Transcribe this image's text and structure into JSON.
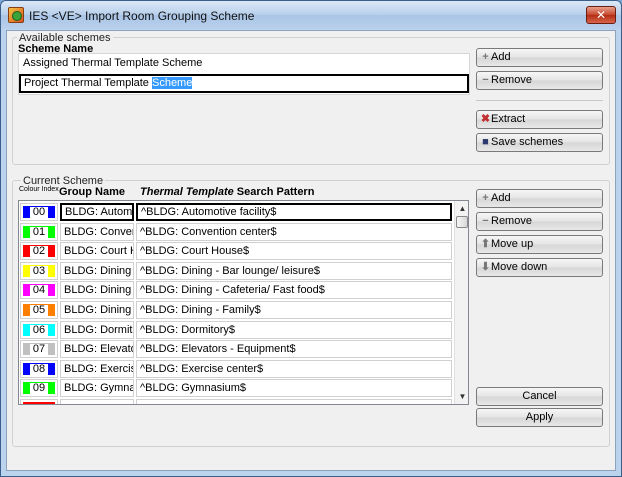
{
  "window": {
    "title": "IES <VE> Import Room Grouping Scheme",
    "close_label": "✕"
  },
  "available": {
    "legend": "Available schemes",
    "header": "Scheme Name",
    "schemes": [
      {
        "label": "Assigned Thermal Template Scheme"
      },
      {
        "label_plain": "Project Thermal Template ",
        "label_highlight": "Scheme"
      }
    ],
    "buttons": {
      "add": "Add",
      "remove": "Remove",
      "extract": "Extract",
      "save": "Save schemes"
    }
  },
  "current": {
    "legend": "Current Scheme",
    "col_index": "Colour Index",
    "col_group": "Group Name",
    "col_pattern_italic": "Thermal Template",
    "col_pattern_rest": " Search Pattern",
    "rows": [
      {
        "index": "00",
        "color": "#0000ff",
        "group": "BLDG: Automotiv",
        "pattern": "^BLDG: Automotive facility$"
      },
      {
        "index": "01",
        "color": "#00ff00",
        "group": "BLDG: Conventio",
        "pattern": "^BLDG: Convention center$"
      },
      {
        "index": "02",
        "color": "#ff0000",
        "group": "BLDG: Court Hou",
        "pattern": "^BLDG: Court House$"
      },
      {
        "index": "03",
        "color": "#ffff00",
        "group": "BLDG: Dining - B",
        "pattern": "^BLDG: Dining - Bar lounge/ leisure$"
      },
      {
        "index": "04",
        "color": "#ff00ff",
        "group": "BLDG: Dining - C",
        "pattern": "^BLDG: Dining - Cafeteria/ Fast food$"
      },
      {
        "index": "05",
        "color": "#ff8000",
        "group": "BLDG: Dining - Fa",
        "pattern": "^BLDG: Dining - Family$"
      },
      {
        "index": "06",
        "color": "#00ffff",
        "group": "BLDG: Dormitory",
        "pattern": "^BLDG: Dormitory$"
      },
      {
        "index": "07",
        "color": "#c0c0c0",
        "group": "BLDG: Elevators",
        "pattern": "^BLDG: Elevators - Equipment$"
      },
      {
        "index": "08",
        "color": "#0000ff",
        "group": "BLDG: Exercise c",
        "pattern": "^BLDG: Exercise center$"
      },
      {
        "index": "09",
        "color": "#00ff00",
        "group": "BLDG: Gymnasiu",
        "pattern": "^BLDG: Gymnasium$"
      },
      {
        "index": "",
        "color": "#ff0000",
        "group": "",
        "pattern": ""
      }
    ],
    "buttons": {
      "add": "Add",
      "remove": "Remove",
      "move_up": "Move up",
      "move_down": "Move down"
    }
  },
  "footer": {
    "cancel": "Cancel",
    "apply": "Apply"
  },
  "icons": {
    "add": "plus-icon",
    "remove": "minus-icon",
    "extract": "extract-icon",
    "save": "save-icon",
    "up": "arrow-up-icon",
    "down": "arrow-down-icon"
  }
}
